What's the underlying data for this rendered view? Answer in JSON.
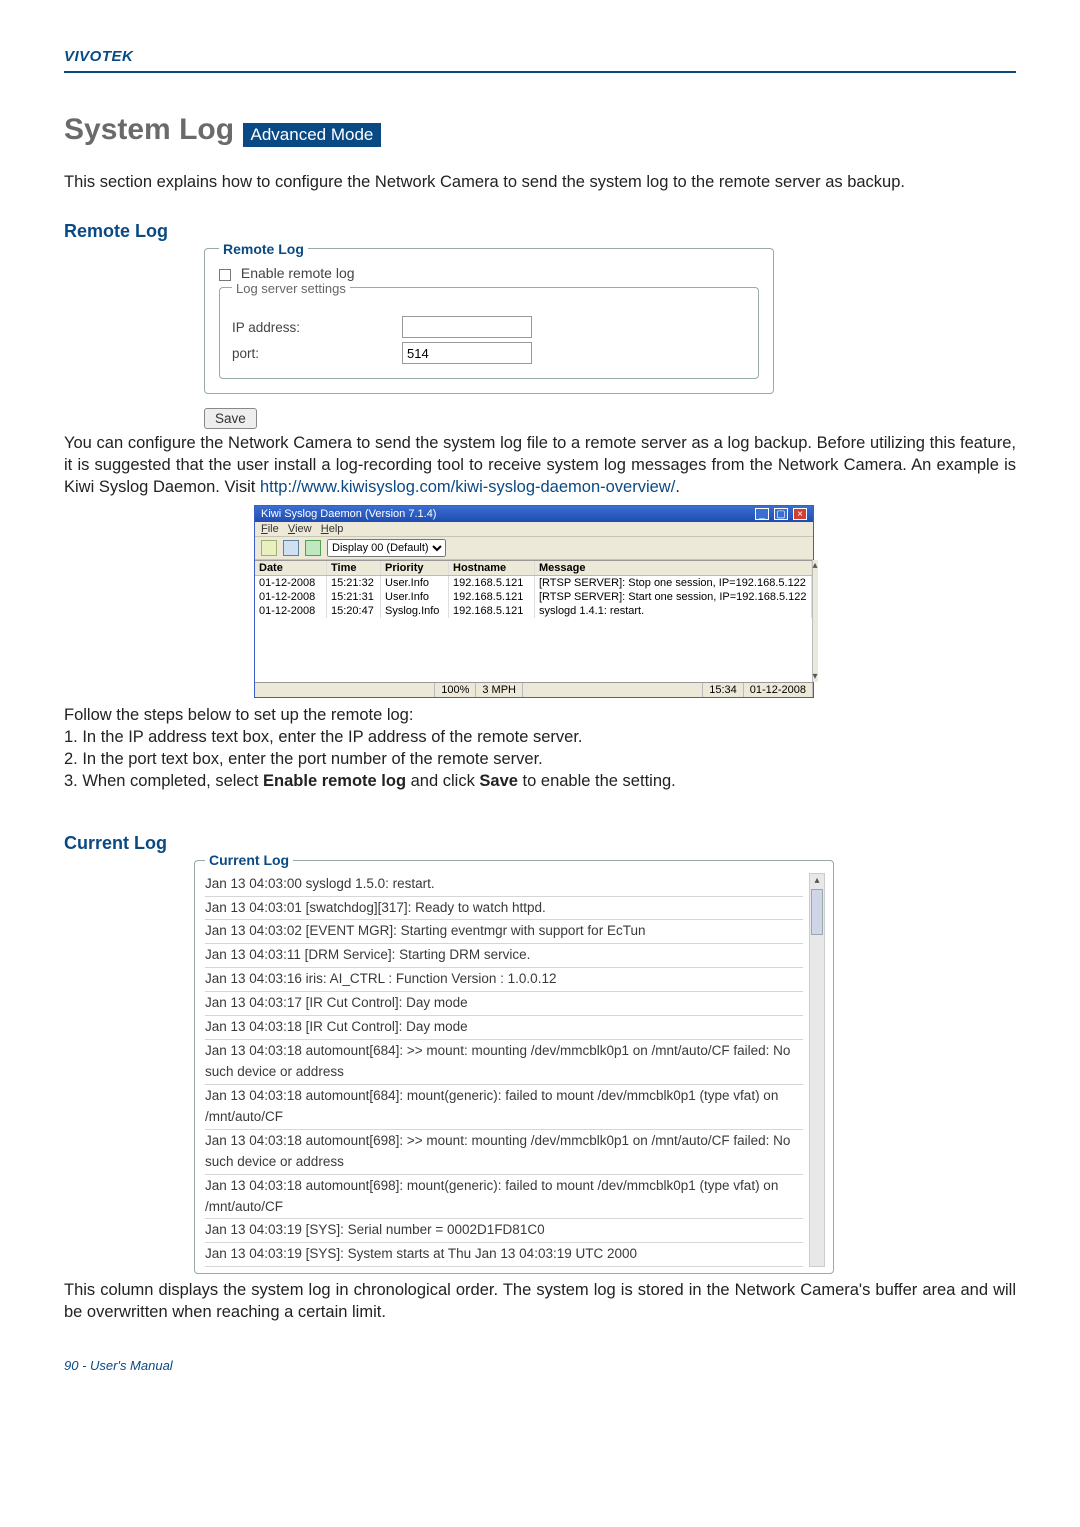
{
  "brand": "VIVOTEK",
  "title": "System Log",
  "modeBadge": "Advanced Mode",
  "intro": "This section explains how to configure the Network Camera to send the system log to the remote server as backup.",
  "remoteLog": {
    "heading": "Remote Log",
    "legend": "Remote Log",
    "enableLabel": "Enable remote log",
    "settingsLegend": "Log server settings",
    "ipLabel": "IP address:",
    "ipValue": "",
    "portLabel": "port:",
    "portValue": "514",
    "saveLabel": "Save"
  },
  "configPara": {
    "part1": "You can configure the Network Camera to send the system log file to a remote server as a log backup. Before utilizing this feature, it is suggested that the user install a log-recording tool to receive system log messages from the Network Camera. An example is Kiwi Syslog Daemon. Visit ",
    "link": "http://www.kiwisyslog.com/kiwi-syslog-daemon-overview/",
    "part2": "."
  },
  "kiwi": {
    "title": "Kiwi Syslog Daemon (Version 7.1.4)",
    "menu": {
      "file": "File",
      "view": "View",
      "help": "Help"
    },
    "displayLabel": "Display 00 (Default)",
    "headers": {
      "date": "Date",
      "time": "Time",
      "priority": "Priority",
      "hostname": "Hostname",
      "message": "Message"
    },
    "rows": [
      {
        "date": "01-12-2008",
        "time": "15:21:32",
        "pri": "User.Info",
        "host": "192.168.5.121",
        "msg": "[RTSP SERVER]: Stop one session, IP=192.168.5.122"
      },
      {
        "date": "01-12-2008",
        "time": "15:21:31",
        "pri": "User.Info",
        "host": "192.168.5.121",
        "msg": "[RTSP SERVER]: Start one session, IP=192.168.5.122"
      },
      {
        "date": "01-12-2008",
        "time": "15:20:47",
        "pri": "Syslog.Info",
        "host": "192.168.5.121",
        "msg": "syslogd 1.4.1: restart."
      }
    ],
    "status": {
      "pct": "100%",
      "mph": "3 MPH",
      "time": "15:34",
      "date": "01-12-2008"
    }
  },
  "followSteps": {
    "lead": "Follow the steps below to set up the remote log:",
    "s1": "1. In the IP address text box, enter the IP address of the remote server.",
    "s2": "2. In the port text box, enter the port number of the remote server.",
    "s3a": "3. When completed, select ",
    "s3b": "Enable remote log",
    "s3c": " and click ",
    "s3d": "Save",
    "s3e": " to enable the setting."
  },
  "currentLog": {
    "heading": "Current Log",
    "legend": "Current Log",
    "lines": [
      "Jan 13 04:03:00 syslogd 1.5.0: restart.",
      "Jan 13 04:03:01 [swatchdog][317]: Ready to watch httpd.",
      "Jan 13 04:03:02 [EVENT MGR]: Starting eventmgr with support for EcTun",
      "Jan 13 04:03:11 [DRM Service]: Starting DRM service.",
      "Jan 13 04:03:16 iris: AI_CTRL : Function Version : 1.0.0.12",
      "Jan 13 04:03:17 [IR Cut Control]: Day mode",
      "Jan 13 04:03:18 [IR Cut Control]: Day mode",
      "Jan 13 04:03:18 automount[684]: >> mount: mounting /dev/mmcblk0p1 on /mnt/auto/CF failed: No such device or address",
      "Jan 13 04:03:18 automount[684]: mount(generic): failed to mount /dev/mmcblk0p1 (type vfat) on /mnt/auto/CF",
      "Jan 13 04:03:18 automount[698]: >> mount: mounting /dev/mmcblk0p1 on /mnt/auto/CF failed: No such device or address",
      "Jan 13 04:03:18 automount[698]: mount(generic): failed to mount /dev/mmcblk0p1 (type vfat) on /mnt/auto/CF",
      "Jan 13 04:03:19 [SYS]: Serial number = 0002D1FD81C0",
      "Jan 13 04:03:19 [SYS]: System starts at Thu Jan 13 04:03:19 UTC 2000"
    ]
  },
  "footerPara": "This column displays the system log in chronological order. The system log is stored in the Network Camera's buffer area and will be overwritten when reaching a certain limit.",
  "pageFooter": "90 - User's Manual"
}
